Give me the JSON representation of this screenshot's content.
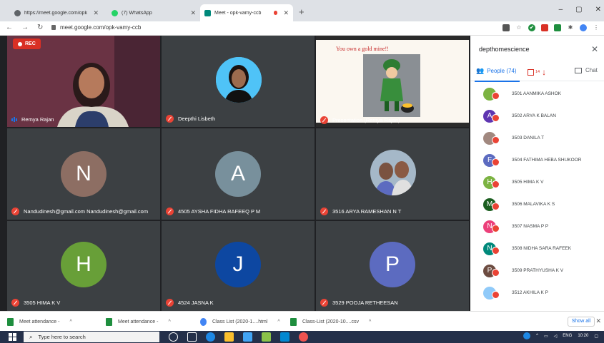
{
  "browser": {
    "tabs": [
      {
        "title": "https://meet.google.com/opk-va",
        "color": "#5f6368"
      },
      {
        "title": "(7) WhatsApp",
        "color": "#25d366"
      },
      {
        "title": "Meet - opk-vamy-ccb",
        "color": "#00897b"
      }
    ],
    "url": "meet.google.com/opk-vamy-ccb"
  },
  "meet": {
    "rec_label": "REC",
    "tiles": [
      {
        "name": "Remya Rajan",
        "type": "video"
      },
      {
        "name": "Deepthi Lisbeth",
        "type": "photo"
      },
      {
        "name": "Presentation (Remya Rajan)",
        "type": "presentation",
        "slide_text": "You own a gold mine!!"
      },
      {
        "name": "Nandudinesh@gmail.com Nandudinesh@gmail.com",
        "type": "avatar",
        "initial": "N",
        "color": "#8d6e63"
      },
      {
        "name": "4505 AYSHA FIDHA RAFEEQ P M",
        "type": "avatar",
        "initial": "A",
        "color": "#78909c"
      },
      {
        "name": "3516 ARYA RAMESHAN N T",
        "type": "photo"
      },
      {
        "name": "3505 HIMA K V",
        "type": "avatar",
        "initial": "H",
        "color": "#689f38"
      },
      {
        "name": "4524 JASNA K",
        "type": "avatar",
        "initial": "J",
        "color": "#0d47a1"
      },
      {
        "name": "3529 POOJA RETHEESAN",
        "type": "avatar",
        "initial": "P",
        "color": "#5c6bc0"
      }
    ]
  },
  "panel": {
    "title": "depthomescience",
    "people_tab": "People (74)",
    "chat_tab": "Chat",
    "raise_count": "14",
    "participants": [
      {
        "name": "3501 AANMIKA ASHOK",
        "initial": "",
        "color": "#7cb342"
      },
      {
        "name": "3502 ARYA K BALAN",
        "initial": "A",
        "color": "#5e35b1"
      },
      {
        "name": "3503 DANILA T",
        "initial": "",
        "color": "#a1887f"
      },
      {
        "name": "3504 FATHIMA HEBA SHUKOOR",
        "initial": "F",
        "color": "#5c6bc0"
      },
      {
        "name": "3505 HIMA K V",
        "initial": "H",
        "color": "#7cb342"
      },
      {
        "name": "3506 MALAVIKA K S",
        "initial": "M",
        "color": "#1b5e20"
      },
      {
        "name": "3507 NASMA P P",
        "initial": "N",
        "color": "#ec407a"
      },
      {
        "name": "3508 NIDHA SARA RAFEEK",
        "initial": "N",
        "color": "#00897b"
      },
      {
        "name": "3509 PRATHYUSHA K V",
        "initial": "P",
        "color": "#6d4c41"
      },
      {
        "name": "3512 AKHILA K P",
        "initial": "",
        "color": "#90caf9"
      }
    ]
  },
  "downloads": {
    "items": [
      "Meet attendance -",
      "Meet attendance -",
      "Class List (2020-1....html",
      "Class-List (2020-10....csv"
    ],
    "show_all": "Show all"
  },
  "taskbar": {
    "search_placeholder": "Type here to search",
    "lang": "ENG",
    "time": "10:20"
  }
}
